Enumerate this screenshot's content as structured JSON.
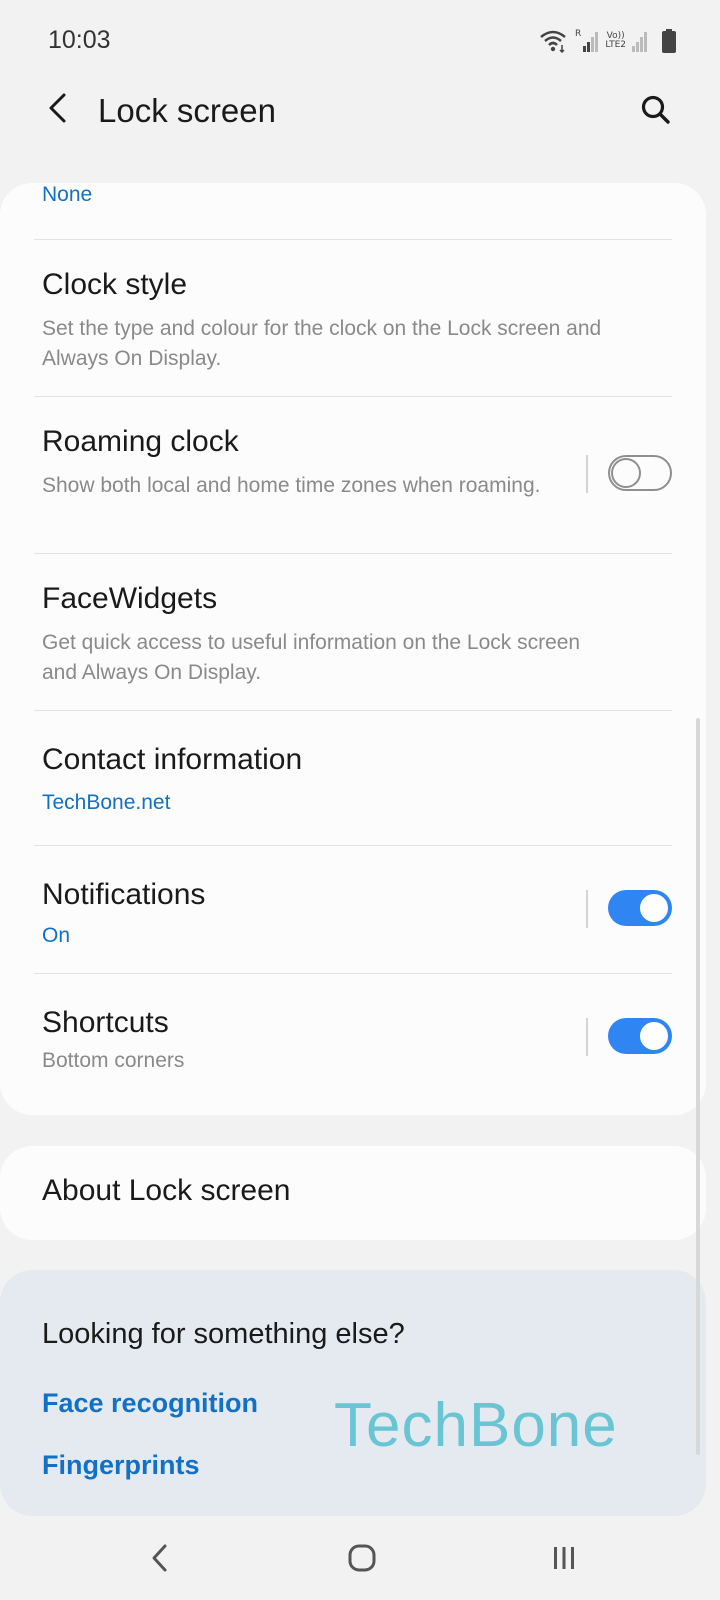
{
  "status_bar": {
    "time": "10:03",
    "roaming_indicator": "R",
    "volte_line1": "Vo))",
    "volte_line2": "LTE2",
    "icons": [
      "wifi-icon",
      "signal-icon",
      "battery-icon"
    ]
  },
  "header": {
    "title": "Lock screen",
    "back_icon": "back-arrow-icon",
    "search_icon": "search-icon"
  },
  "settings": {
    "partial_value": "None",
    "clock_style": {
      "title": "Clock style",
      "description": "Set the type and colour for the clock on the Lock screen and Always On Display."
    },
    "roaming_clock": {
      "title": "Roaming clock",
      "description": "Show both local and home time zones when roaming.",
      "enabled": false
    },
    "facewidgets": {
      "title": "FaceWidgets",
      "description": "Get quick access to useful information on the Lock screen and Always On Display."
    },
    "contact_information": {
      "title": "Contact information",
      "value": "TechBone.net"
    },
    "notifications": {
      "title": "Notifications",
      "value": "On",
      "enabled": true
    },
    "shortcuts": {
      "title": "Shortcuts",
      "value": "Bottom corners",
      "enabled": true
    }
  },
  "about": {
    "label": "About Lock screen"
  },
  "suggestions": {
    "title": "Looking for something else?",
    "links": [
      "Face recognition",
      "Fingerprints"
    ]
  },
  "watermark": "TechBone",
  "nav_bar": {
    "icons": [
      "back-icon",
      "home-icon",
      "recent-apps-icon"
    ]
  },
  "colors": {
    "background": "#f2f2f2",
    "card": "#fcfcfc",
    "accent": "#1271c4",
    "toggle_on": "#2f86f2",
    "suggest_bg": "#e5eaf0",
    "watermark": "#5cc0d0"
  }
}
